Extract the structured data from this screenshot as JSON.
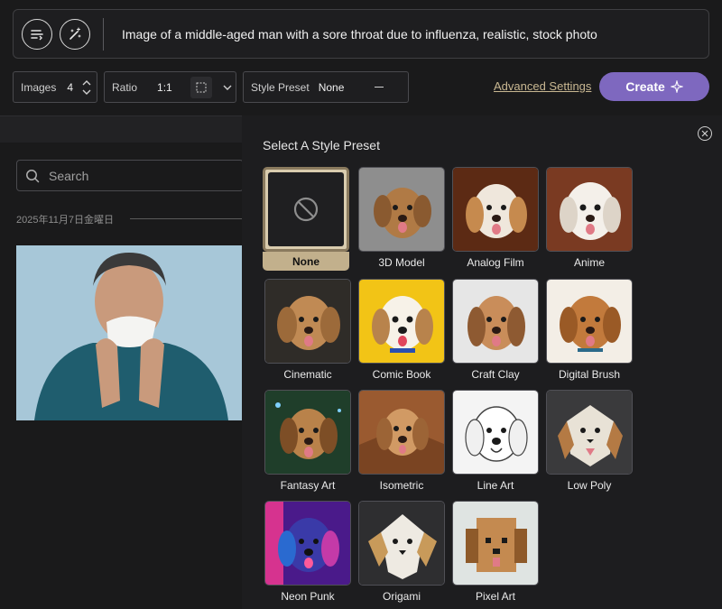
{
  "prompt": {
    "text": "Image of a middle-aged man with a sore throat due to influenza, realistic, stock photo",
    "icons": [
      "prompt-list-icon",
      "magic-wand-icon"
    ]
  },
  "controls": {
    "images_label": "Images",
    "images_value": "4",
    "ratio_label": "Ratio",
    "ratio_value": "1:1",
    "style_label": "Style Preset",
    "style_value": "None",
    "advanced_settings": "Advanced Settings",
    "create_label": "Create"
  },
  "gallery": {
    "search_placeholder": "Search",
    "date_label": "2025年11月7日金曜日"
  },
  "style_panel": {
    "title": "Select A Style Preset",
    "selected": "None",
    "presets": [
      {
        "label": "None"
      },
      {
        "label": "3D Model"
      },
      {
        "label": "Analog Film"
      },
      {
        "label": "Anime"
      },
      {
        "label": "Cinematic"
      },
      {
        "label": "Comic Book"
      },
      {
        "label": "Craft Clay"
      },
      {
        "label": "Digital Brush"
      },
      {
        "label": "Fantasy Art"
      },
      {
        "label": "Isometric"
      },
      {
        "label": "Line Art"
      },
      {
        "label": "Low Poly"
      },
      {
        "label": "Neon Punk"
      },
      {
        "label": "Origami"
      },
      {
        "label": "Pixel Art"
      }
    ]
  },
  "colors": {
    "accent": "#7e68bf",
    "selected_tile": "#c2b08c",
    "link": "#c9b892"
  }
}
